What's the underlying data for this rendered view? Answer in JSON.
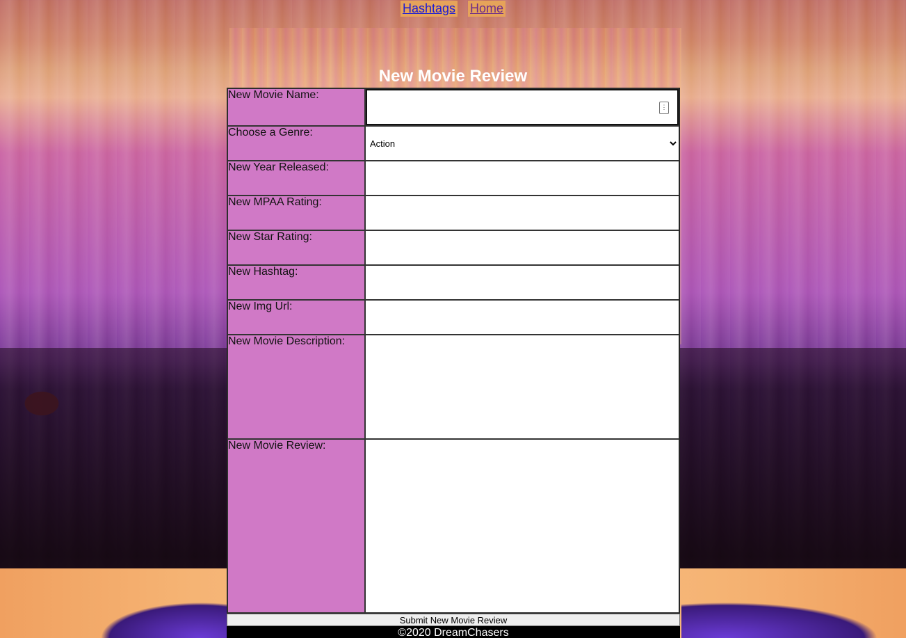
{
  "nav": {
    "links": [
      {
        "label": "Hashtags"
      },
      {
        "label": "Home"
      }
    ]
  },
  "page": {
    "title": "New Movie Review"
  },
  "form": {
    "fields": {
      "name": {
        "label": "New Movie Name:",
        "value": ""
      },
      "genre": {
        "label": "Choose a Genre:",
        "selected": "Action"
      },
      "year": {
        "label": "New Year Released:",
        "value": ""
      },
      "mpaa": {
        "label": "New MPAA Rating:",
        "value": ""
      },
      "star": {
        "label": "New Star Rating:",
        "value": ""
      },
      "hashtag": {
        "label": "New Hashtag:",
        "value": ""
      },
      "img": {
        "label": "New Img Url:",
        "value": ""
      },
      "description": {
        "label": "New Movie Description:",
        "value": ""
      },
      "review": {
        "label": "New Movie Review:",
        "value": ""
      }
    },
    "submit_label": "Submit New Movie Review"
  },
  "footer": {
    "text": "©2020 DreamChasers"
  },
  "colors": {
    "label_bg": "#d079c6",
    "nav_bg": "#e6a35a",
    "footer_bg": "#000000"
  }
}
